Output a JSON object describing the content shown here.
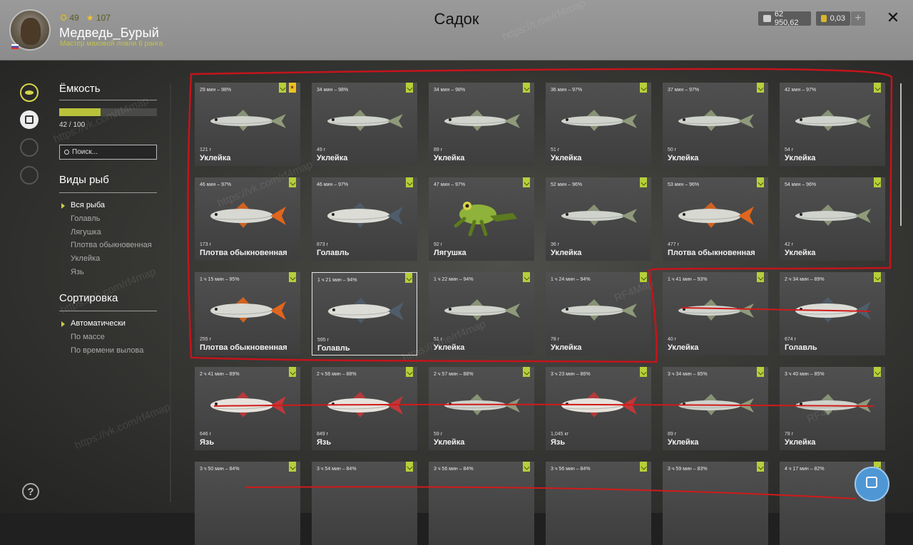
{
  "header": {
    "title": "Садок",
    "player": {
      "name": "Медведь_Бурый",
      "rank": "Мастер маховой ловли 6 ранга",
      "level": "49",
      "stars": "107"
    },
    "currency": {
      "silver": "62 950,62",
      "gold": "0,03"
    },
    "plus_label": "+",
    "close_label": "✕"
  },
  "sidebar": {
    "capacity_title": "Ёмкость",
    "capacity_text": "42 / 100",
    "capacity_fraction": 0.42,
    "search_placeholder": "Поиск...",
    "species_title": "Виды рыб",
    "species": [
      "Вся рыба",
      "Голавль",
      "Лягушка",
      "Плотва обыкновенная",
      "Уклейка",
      "Язь"
    ],
    "sort_title": "Сортировка",
    "sort_options": [
      "Автоматически",
      "По массе",
      "По времени вылова"
    ],
    "help_label": "?"
  },
  "cards": [
    {
      "time": "29 мин – 98%",
      "weight": "121 г",
      "name": "Уклейка",
      "star": true
    },
    {
      "time": "34 мин – 98%",
      "weight": "49 г",
      "name": "Уклейка"
    },
    {
      "time": "34 мин – 98%",
      "weight": "89 г",
      "name": "Уклейка"
    },
    {
      "time": "36 мин – 97%",
      "weight": "51 г",
      "name": "Уклейка"
    },
    {
      "time": "37 мин – 97%",
      "weight": "50 г",
      "name": "Уклейка"
    },
    {
      "time": "42 мин – 97%",
      "weight": "54 г",
      "name": "Уклейка"
    },
    {
      "time": "46 мин – 97%",
      "weight": "173 г",
      "name": "Плотва обыкновенная"
    },
    {
      "time": "46 мин – 97%",
      "weight": "873 г",
      "name": "Голавль"
    },
    {
      "time": "47 мин – 97%",
      "weight": "92 г",
      "name": "Лягушка"
    },
    {
      "time": "52 мин – 96%",
      "weight": "36 г",
      "name": "Уклейка"
    },
    {
      "time": "53 мин – 96%",
      "weight": "477 г",
      "name": "Плотва обыкновенная"
    },
    {
      "time": "54 мин – 96%",
      "weight": "42 г",
      "name": "Уклейка"
    },
    {
      "time": "1 ч 15 мин – 95%",
      "weight": "255 г",
      "name": "Плотва обыкновенная"
    },
    {
      "time": "1 ч 21 мин – 94%",
      "weight": "595 г",
      "name": "Голавль",
      "selected": true
    },
    {
      "time": "1 ч 22 мин – 94%",
      "weight": "51 г",
      "name": "Уклейка"
    },
    {
      "time": "1 ч 24 мин – 94%",
      "weight": "78 г",
      "name": "Уклейка"
    },
    {
      "time": "1 ч 41 мин – 93%",
      "weight": "40 г",
      "name": "Уклейка"
    },
    {
      "time": "2 ч 34 мин – 89%",
      "weight": "674 г",
      "name": "Голавль"
    },
    {
      "time": "2 ч 41 мин – 89%",
      "weight": "646 г",
      "name": "Язь"
    },
    {
      "time": "2 ч 56 мин – 88%",
      "weight": "849 г",
      "name": "Язь"
    },
    {
      "time": "2 ч 57 мин – 88%",
      "weight": "59 г",
      "name": "Уклейка"
    },
    {
      "time": "3 ч 23 мин – 86%",
      "weight": "1,045 кг",
      "name": "Язь"
    },
    {
      "time": "3 ч 34 мин – 85%",
      "weight": "89 г",
      "name": "Уклейка"
    },
    {
      "time": "3 ч 40 мин – 85%",
      "weight": "78 г",
      "name": "Уклейка"
    },
    {
      "time": "3 ч 50 мин – 84%",
      "weight": "",
      "name": ""
    },
    {
      "time": "3 ч 54 мин – 84%",
      "weight": "",
      "name": ""
    },
    {
      "time": "3 ч 56 мин – 84%",
      "weight": "",
      "name": ""
    },
    {
      "time": "3 ч 56 мин – 84%",
      "weight": "",
      "name": ""
    },
    {
      "time": "3 ч 59 мин – 83%",
      "weight": "",
      "name": ""
    },
    {
      "time": "4 ч 17 мин – 82%",
      "weight": "",
      "name": ""
    }
  ],
  "watermarks": [
    "RF4Map",
    "https://vk.com/rf4map",
    "https://t.me/rf4map"
  ],
  "colors": {
    "accent": "#b9c23a",
    "tag_green": "#b7cf3a",
    "tag_star": "#f0c221",
    "annotation_red": "#d11a1a",
    "cursor_button": "#4f97d4"
  },
  "icons": {
    "nav": [
      "fish-icon",
      "keepnet-icon",
      "bait-icon",
      "home-icon"
    ],
    "help": "help-icon",
    "cursor": "cursor-mode-icon"
  }
}
